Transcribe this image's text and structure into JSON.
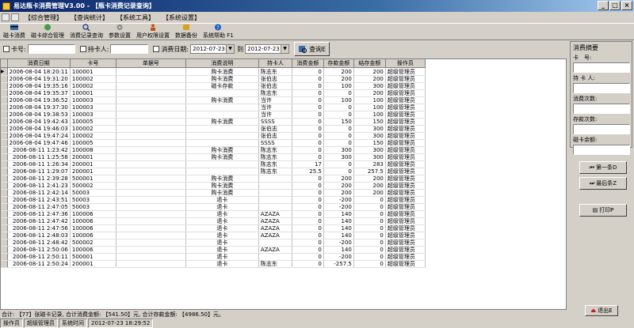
{
  "window": {
    "title": "易达瓶卡消费管理V3.00 - 【瓶卡消费记录查询】"
  },
  "menu": [
    "【综合管理】",
    "【查询统计】",
    "【系统工具】",
    "【系统设置】"
  ],
  "toolbar": [
    "磁卡消费",
    "磁卡综合管理",
    "消费记录查询",
    "参数设置",
    "用户权限设置",
    "数据备份",
    "系统帮助 F1"
  ],
  "filters": {
    "card_label": "卡号:",
    "holder_label": "持卡人:",
    "date_label": "消费日期:",
    "date_from": "2012-07-23",
    "to_label": "到",
    "date_to": "2012-07-23",
    "query_btn": "查询E"
  },
  "table": {
    "columns": [
      "消费日期",
      "卡号",
      "单据号",
      "消费说明",
      "持卡人",
      "消费金额",
      "存款金额",
      "结存金额",
      "操作员"
    ],
    "rows": [
      [
        "2006-08-04 18:20:11",
        "100001",
        "",
        "购卡消费",
        "陈志东",
        "0",
        "200",
        "200",
        "超级管理员"
      ],
      [
        "2006-08-04 19:31:20",
        "100002",
        "",
        "购卡消费",
        "张伯志",
        "0",
        "200",
        "200",
        "超级管理员"
      ],
      [
        "2006-08-04 19:35:16",
        "100002",
        "",
        "磁卡存款",
        "张伯志",
        "0",
        "100",
        "300",
        "超级管理员"
      ],
      [
        "2006-08-04 19:35:37",
        "100001",
        "",
        "",
        "陈志东",
        "0",
        "0",
        "200",
        "超级管理员"
      ],
      [
        "2006-08-04 19:36:52",
        "100003",
        "",
        "购卡消费",
        "当许",
        "0",
        "100",
        "100",
        "超级管理员"
      ],
      [
        "2006-08-04 19:37:30",
        "100003",
        "",
        "",
        "当许",
        "0",
        "0",
        "100",
        "超级管理员"
      ],
      [
        "2006-08-04 19:38:53",
        "100003",
        "",
        "",
        "当许",
        "0",
        "0",
        "100",
        "超级管理员"
      ],
      [
        "2006-08-04 19:42:43",
        "100005",
        "",
        "购卡消费",
        "SSSS",
        "0",
        "150",
        "150",
        "超级管理员"
      ],
      [
        "2006-08-04 19:46:03",
        "100002",
        "",
        "",
        "张伯志",
        "0",
        "0",
        "300",
        "超级管理员"
      ],
      [
        "2006-08-04 19:47:24",
        "100002",
        "",
        "",
        "张伯志",
        "0",
        "0",
        "300",
        "超级管理员"
      ],
      [
        "2006-08-04 19:47:46",
        "100005",
        "",
        "",
        "SSSS",
        "0",
        "0",
        "150",
        "超级管理员"
      ],
      [
        "2006-08-11 1:23:42",
        "100008",
        "",
        "购卡消费",
        "陈志东",
        "0",
        "300",
        "300",
        "超级管理员"
      ],
      [
        "2006-08-11 1:25:58",
        "200001",
        "",
        "购卡消费",
        "陈志东",
        "0",
        "300",
        "300",
        "超级管理员"
      ],
      [
        "2006-08-11 1:26:34",
        "200001",
        "",
        "",
        "陈志东",
        "17",
        "0",
        "283",
        "超级管理员"
      ],
      [
        "2006-08-11 1:29:07",
        "200001",
        "",
        "",
        "陈志东",
        "25.5",
        "0",
        "257.5",
        "超级管理员"
      ],
      [
        "2006-08-11 2:39:28",
        "500001",
        "",
        "购卡消费",
        "",
        "0",
        "200",
        "200",
        "超级管理员"
      ],
      [
        "2006-08-11 2:41:23",
        "500002",
        "",
        "购卡消费",
        "",
        "0",
        "200",
        "200",
        "超级管理员"
      ],
      [
        "2006-08-11 2:42:14",
        "50003",
        "",
        "购卡消费",
        "",
        "0",
        "200",
        "200",
        "超级管理员"
      ],
      [
        "2006-08-11 2:43:51",
        "50003",
        "",
        "退卡",
        "",
        "0",
        "-200",
        "0",
        "超级管理员"
      ],
      [
        "2006-08-11 2:47:05",
        "50003",
        "",
        "退卡",
        "",
        "0",
        "-200",
        "0",
        "超级管理员"
      ],
      [
        "2006-08-11 2:47:36",
        "100006",
        "",
        "退卡",
        "AZAZA",
        "0",
        "140",
        "0",
        "超级管理员"
      ],
      [
        "2006-08-11 2:47:42",
        "100006",
        "",
        "退卡",
        "AZAZA",
        "0",
        "140",
        "0",
        "超级管理员"
      ],
      [
        "2006-08-11 2:47:56",
        "100006",
        "",
        "退卡",
        "AZAZA",
        "0",
        "140",
        "0",
        "超级管理员"
      ],
      [
        "2006-08-11 2:48:03",
        "100006",
        "",
        "退卡",
        "AZAZA",
        "0",
        "140",
        "0",
        "超级管理员"
      ],
      [
        "2006-08-11 2:48:42",
        "500002",
        "",
        "退卡",
        "",
        "0",
        "-200",
        "0",
        "超级管理员"
      ],
      [
        "2006-08-11 2:50:06",
        "100006",
        "",
        "退卡",
        "AZAZA",
        "0",
        "140",
        "0",
        "超级管理员"
      ],
      [
        "2006-08-11 2:50:11",
        "500001",
        "",
        "退卡",
        "",
        "0",
        "-200",
        "0",
        "超级管理员"
      ],
      [
        "2006-08-11 2:50:24",
        "200001",
        "",
        "退卡",
        "陈志东",
        "0",
        "-257.5",
        "0",
        "超级管理员"
      ]
    ]
  },
  "summary": {
    "title": "消费摘要",
    "card": "卡　号:",
    "holder": "持 卡 人:",
    "count": "消费次数:",
    "deposit_count": "存款次数:",
    "balance": "磁卡余额:"
  },
  "nav": {
    "first": "第一条D",
    "last": "最后条Z",
    "print": "打印P",
    "exit": "退出E"
  },
  "totals": "合计: 【77】张磁卡记录, 合计消费金额: 【541.50】元, 合计存款金额: 【4986.50】元。",
  "status": [
    "操作员",
    "超级管理员",
    "系统时间",
    "2012-07-23  18:29:52"
  ]
}
